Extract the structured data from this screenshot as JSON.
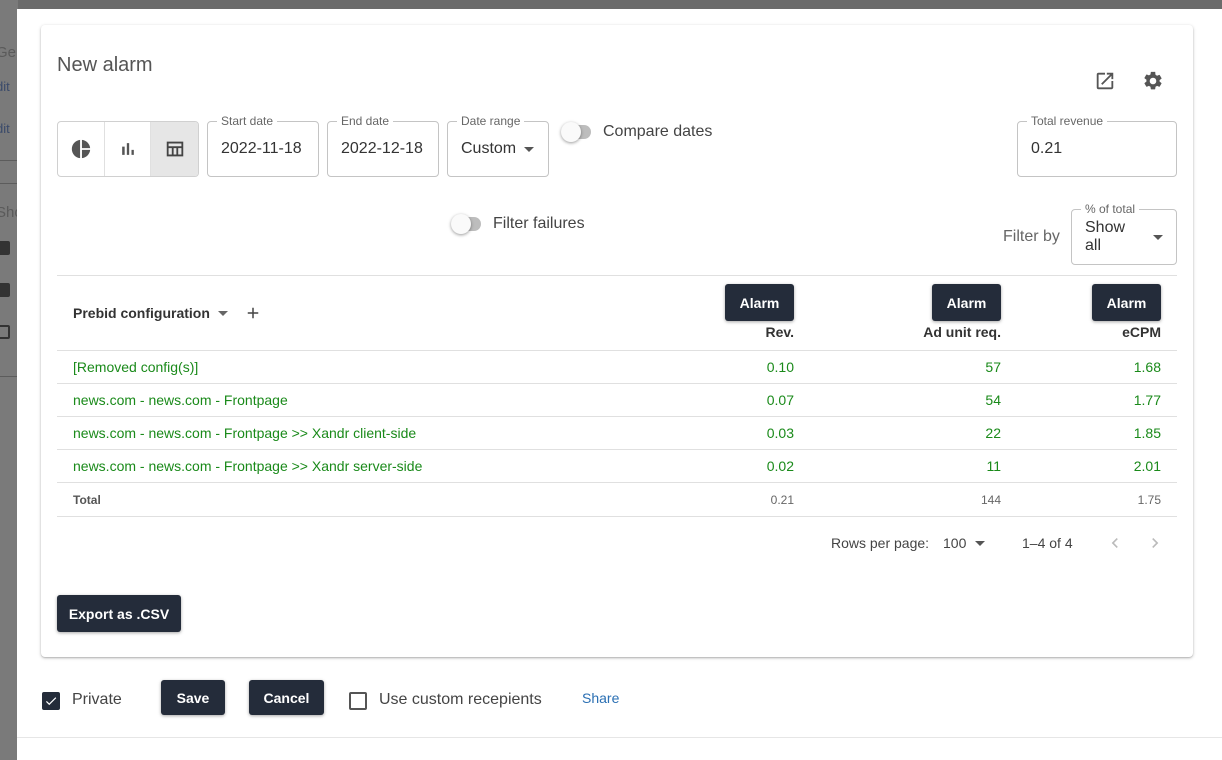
{
  "background": {
    "fragments": [
      "Ger",
      "dit",
      "dit",
      "Sho"
    ]
  },
  "dialog": {
    "title": "New alarm",
    "icons": [
      "open-in-new-icon",
      "gear-icon"
    ],
    "visualization_toggle": {
      "options": [
        "pie-chart-icon",
        "bar-chart-icon",
        "table-icon"
      ],
      "selected": "table-icon"
    },
    "start_date": {
      "label": "Start date",
      "value": "2022-11-18"
    },
    "end_date": {
      "label": "End date",
      "value": "2022-12-18"
    },
    "date_range": {
      "label": "Date range",
      "value": "Custom"
    },
    "compare_dates": {
      "label": "Compare dates",
      "checked": false
    },
    "total_revenue": {
      "label": "Total revenue",
      "value": "0.21"
    },
    "filter_failures": {
      "label": "Filter failures",
      "checked": false
    },
    "filter_by": {
      "label": "Filter by",
      "select_label": "% of total",
      "value": "Show all"
    },
    "table": {
      "group_header": "Prebid configuration",
      "alarm_label": "Alarm",
      "columns": [
        "Rev.",
        "Ad unit req.",
        "eCPM"
      ],
      "rows": [
        {
          "name": "[Removed config(s)]",
          "rev": "0.10",
          "req": "57",
          "ecpm": "1.68"
        },
        {
          "name": "news.com - news.com - Frontpage",
          "rev": "0.07",
          "req": "54",
          "ecpm": "1.77"
        },
        {
          "name": "news.com - news.com - Frontpage >> Xandr client-side",
          "rev": "0.03",
          "req": "22",
          "ecpm": "1.85"
        },
        {
          "name": "news.com - news.com - Frontpage >> Xandr server-side",
          "rev": "0.02",
          "req": "11",
          "ecpm": "2.01"
        }
      ],
      "total": {
        "label": "Total",
        "rev": "0.21",
        "req": "144",
        "ecpm": "1.75"
      },
      "row_color": "#1a8a1a"
    },
    "pagination": {
      "rows_per_page_label": "Rows per page:",
      "rows_per_page": "100",
      "range": "1–4 of 4"
    },
    "export_button": "Export as .CSV"
  },
  "footer": {
    "private": {
      "label": "Private",
      "checked": true
    },
    "save_button": "Save",
    "cancel_button": "Cancel",
    "custom_recipients": {
      "label": "Use custom recepients",
      "checked": false
    },
    "share_link": "Share"
  },
  "colors": {
    "button_dark": "#242c3a",
    "link": "#2a6fb3",
    "positive": "#1a8a1a"
  }
}
